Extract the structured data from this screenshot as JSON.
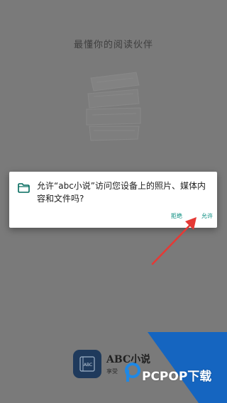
{
  "splash": {
    "slogan": "最懂你的阅读伙伴"
  },
  "dialog": {
    "message": "允许“abc小说”访问您设备上的照片、媒体内容和文件吗?",
    "deny_label": "拒绝",
    "allow_label": "允许",
    "icon": "folder-icon"
  },
  "app": {
    "name": "ABC小说",
    "tagline": "享受",
    "logo_text": "ABC"
  },
  "watermark": {
    "text": "PCPOP下载"
  },
  "colors": {
    "overlay": "#7a7a7a",
    "accent": "#00897b",
    "annotation_arrow": "#e53935",
    "watermark_blue": "#1565c0"
  }
}
